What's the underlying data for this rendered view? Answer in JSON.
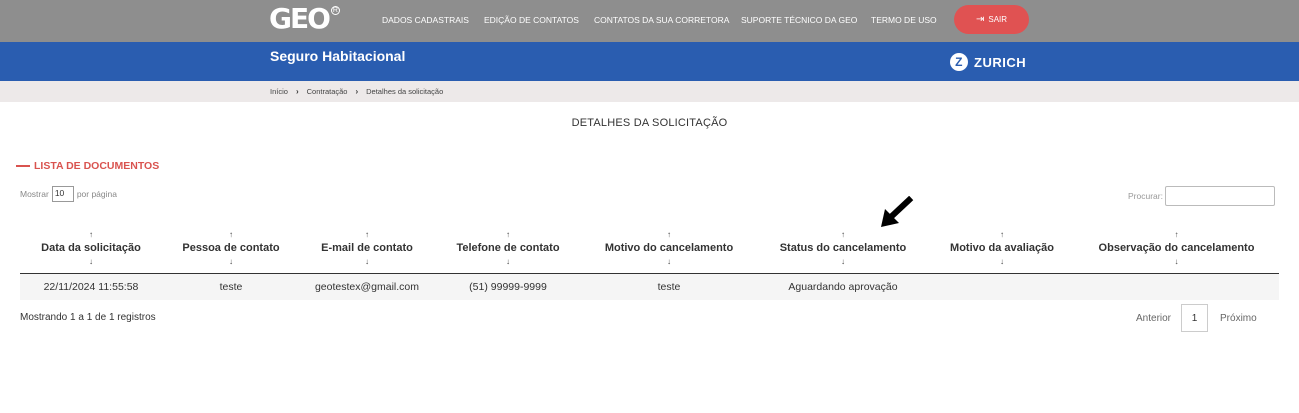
{
  "header": {
    "logo": "GEO",
    "nav": [
      "DADOS CADASTRAIS",
      "EDIÇÃO DE CONTATOS",
      "CONTATOS DA SUA CORRETORA",
      "SUPORTE TÉCNICO DA GEO",
      "TERMO DE USO"
    ],
    "logout_label": "SAIR",
    "logout_icon": "exit-icon",
    "logout_color": "#e05252"
  },
  "banner": {
    "title": "Seguro Habitacional",
    "partner": "ZURICH",
    "color": "#2a5db0"
  },
  "breadcrumb": [
    "Início",
    "Contratação",
    "Detalhes da solicitação"
  ],
  "page": {
    "title": "DETALHES DA SOLICITAÇÃO",
    "section_title": "LISTA DE DOCUMENTOS",
    "accent": "#d9534f"
  },
  "table_controls": {
    "show_prefix": "Mostrar",
    "page_size": "10",
    "show_suffix": "por página",
    "search_label": "Procurar:",
    "search_value": ""
  },
  "table": {
    "columns": [
      "Data da solicitação",
      "Pessoa de contato",
      "E-mail de contato",
      "Telefone de contato",
      "Motivo do cancelamento",
      "Status do cancelamento",
      "Motivo da avaliação",
      "Observação do cancelamento"
    ],
    "sort_up": "↑",
    "sort_down": "↓",
    "rows": [
      [
        "22/11/2024 11:55:58",
        "teste",
        "geotestex@gmail.com",
        "(51) 99999-9999",
        "teste",
        "Aguardando aprovação",
        "",
        ""
      ]
    ]
  },
  "footer": {
    "info": "Mostrando 1 a 1 de 1 registros",
    "prev": "Anterior",
    "page": "1",
    "next": "Próximo"
  }
}
